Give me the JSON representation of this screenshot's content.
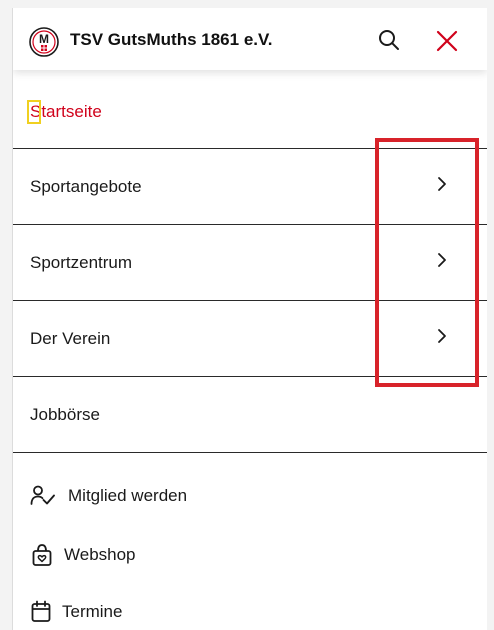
{
  "header": {
    "brand": "TSV GutsMuths 1861 e.V.",
    "logo_letter": "M",
    "accent_color": "#d0021b",
    "icons": [
      "search-icon",
      "close-icon"
    ]
  },
  "nav": {
    "home_label": "Startseite",
    "items": [
      {
        "label": "Sportangebote",
        "icon": "chevron-right-icon"
      },
      {
        "label": "Sportzentrum",
        "icon": "chevron-right-icon"
      },
      {
        "label": "Der Verein",
        "icon": "chevron-right-icon"
      },
      {
        "label": "Jobbörse"
      }
    ]
  },
  "utility": {
    "items": [
      {
        "label": "Mitglied werden",
        "icon": "member-check-icon"
      },
      {
        "label": "Webshop",
        "icon": "shopping-bag-icon"
      },
      {
        "label": "Termine",
        "icon": "calendar-icon"
      }
    ]
  },
  "annotation": {
    "highlight_color": "#d8232a"
  }
}
